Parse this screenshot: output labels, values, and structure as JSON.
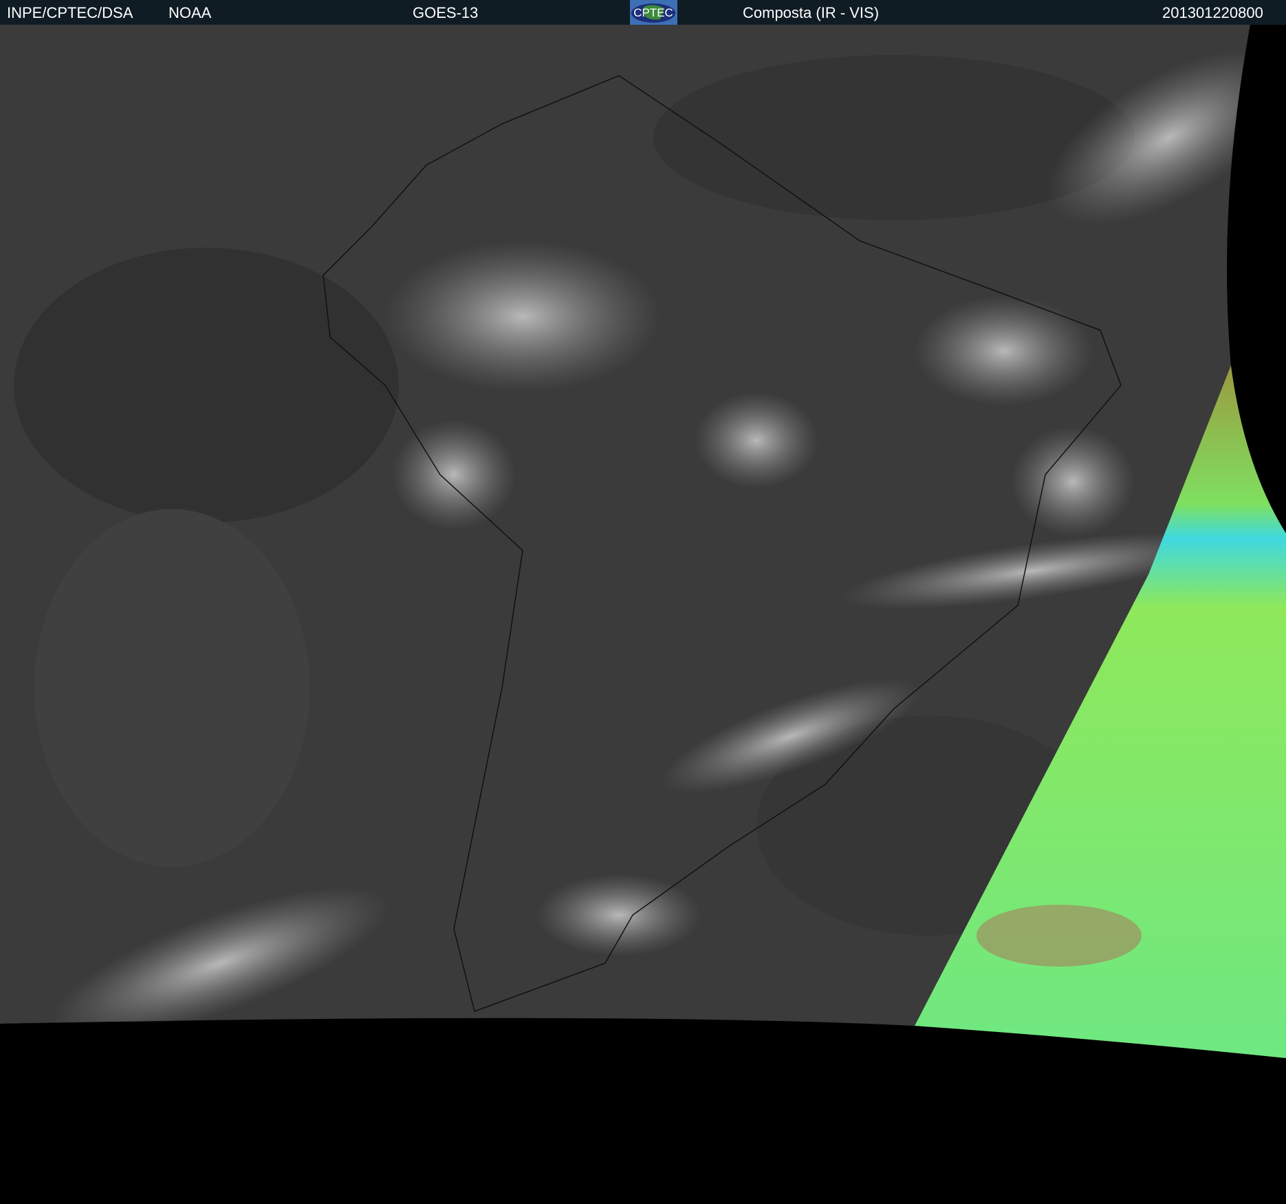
{
  "header": {
    "source": "INPE/CPTEC/DSA",
    "agency": "NOAA",
    "satellite": "GOES-13",
    "logo_text": "CPTEC",
    "product": "Composta (IR - VIS)",
    "timestamp": "201301220800"
  },
  "colors": {
    "header_bg": "#0f1c24",
    "ir_gray": "#3b3b3b",
    "vis_green": "#86e86a",
    "vis_cyan": "#3fe0d8",
    "space": "#000000"
  }
}
